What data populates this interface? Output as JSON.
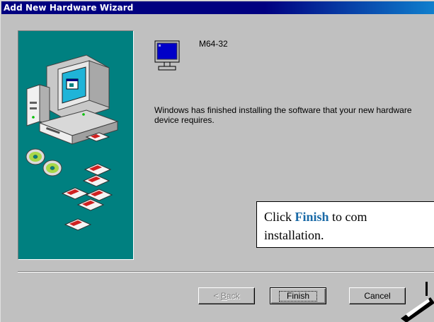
{
  "window": {
    "title": "Add New Hardware Wizard"
  },
  "device": {
    "name": "M64-32",
    "icon": "monitor-icon"
  },
  "message": "Windows has finished installing the software that your new hardware device requires.",
  "callout": {
    "prefix": "Click ",
    "keyword": "Finish",
    "suffix": " to com",
    "line2": "installation."
  },
  "buttons": {
    "back_mnemonic": "B",
    "back_prefix": "< ",
    "back_rest": "ack",
    "back_enabled": false,
    "finish": "Finish",
    "cancel": "Cancel"
  },
  "colors": {
    "title_bar": "#000080",
    "banner": "#008080",
    "dialog_face": "#c0c0c0",
    "callout_keyword": "#1a6aa7"
  }
}
